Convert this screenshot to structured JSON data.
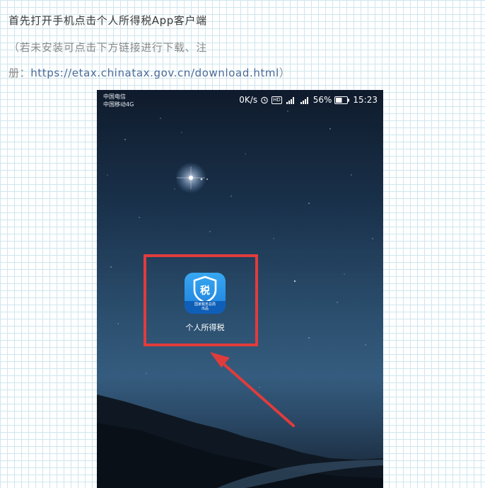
{
  "article": {
    "line1": "首先打开手机点击个人所得税App客户端",
    "line2": "（若未安装可点击下方链接进行下载、注",
    "line3_prefix": "册：",
    "line3_url": "https://etax.chinatax.gov.cn/download.html",
    "line3_suffix": "）"
  },
  "phone": {
    "status": {
      "carrier1": "中国电信",
      "carrier2": "中国移动4G",
      "speed": "0K/s",
      "hd": "HD",
      "battery": "56%",
      "time": "15:23"
    },
    "app": {
      "label": "个人所得税",
      "icon_glyph": "税",
      "icon_band": "国家税务总局",
      "icon_band2": "出品",
      "icon_name": "tax-shield-icon"
    },
    "highlight_color": "#e03c3c"
  }
}
